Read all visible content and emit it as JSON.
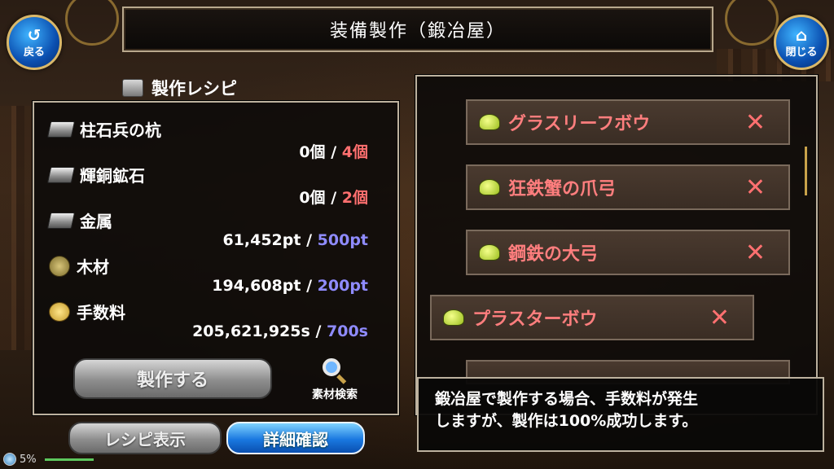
{
  "header": {
    "title": "装備製作（鍛冶屋）",
    "back_label": "戻る",
    "close_label": "閉じる"
  },
  "recipe": {
    "title": "製作レシピ",
    "requirements": [
      {
        "name": "柱石兵の杭",
        "have": "0個",
        "sep": "/",
        "need": "4個",
        "icon": "ingot-icon"
      },
      {
        "name": "輝銅鉱石",
        "have": "0個",
        "sep": "/",
        "need": "2個",
        "icon": "ingot-icon"
      },
      {
        "name": "金属",
        "have": "61,452pt",
        "sep": "/",
        "need": "500pt",
        "icon": "ingot-icon"
      },
      {
        "name": "木材",
        "have": "194,608pt",
        "sep": "/",
        "need": "200pt",
        "icon": "wood-icon"
      },
      {
        "name": "手数料",
        "have": "205,621,925s",
        "sep": "/",
        "need": "700s",
        "icon": "coin-icon"
      }
    ],
    "craft_label": "製作する",
    "search_label": "素材検索"
  },
  "buttons": {
    "recipe_view": "レシピ表示",
    "detail_confirm": "詳細確認"
  },
  "list": {
    "items": [
      {
        "label": "グラスリーフボウ",
        "mark": "✕"
      },
      {
        "label": "狂鉄蟹の爪弓",
        "mark": "✕"
      },
      {
        "label": "鋼鉄の大弓",
        "mark": "✕"
      },
      {
        "label": "プラスターボウ",
        "mark": "✕"
      }
    ]
  },
  "message": {
    "line1": "鍛冶屋で製作する場合、手数料が発生",
    "line2": "しますが、製作は100%成功します。"
  },
  "status": {
    "percent": "5%"
  },
  "colors": {
    "insufficient": "#ff6f6f",
    "sufficient": "#8f8bff",
    "item_text": "#ff7e7e"
  }
}
